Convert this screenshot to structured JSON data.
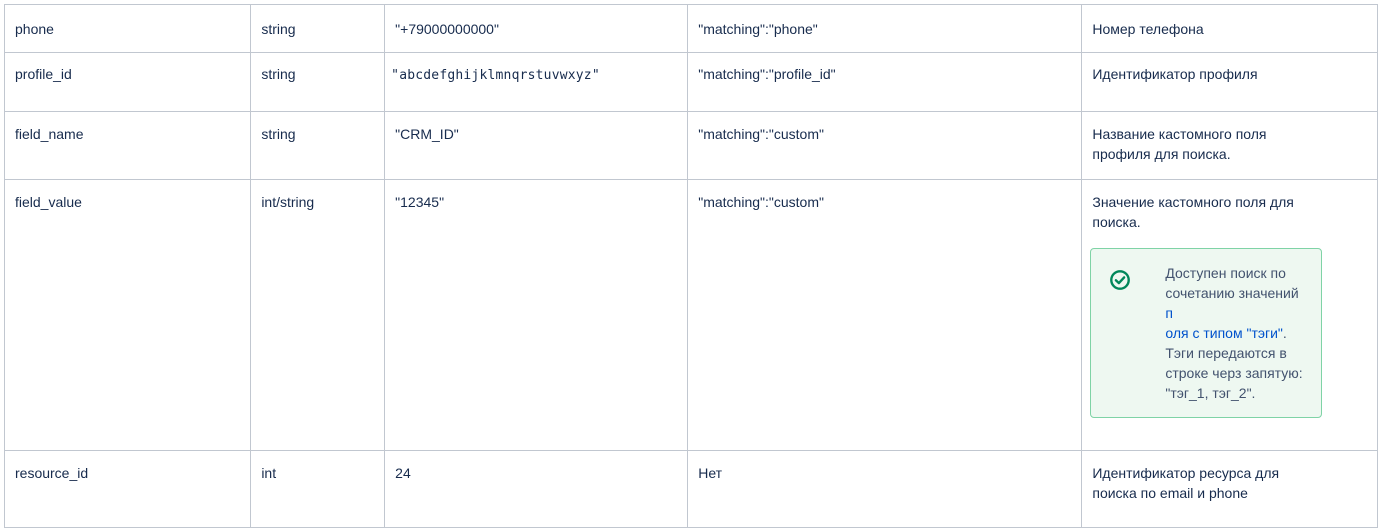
{
  "rows": [
    {
      "name": "phone",
      "type": "string",
      "example": "\"+79000000000\"",
      "matching": "\"matching\":\"phone\"",
      "description": "Номер телефона"
    },
    {
      "name": "profile_id",
      "type": "string",
      "example": "\"abcdefghijklmnqrstuvwxyz\"",
      "matching": "\"matching\":\"profile_id\"",
      "description": "Идентификатор профиля"
    },
    {
      "name": "field_name",
      "type": "string",
      "example": "\"CRM_ID\"",
      "matching": "\"matching\":\"custom\"",
      "description_line1": "Название кастомного поля",
      "description_line2": "профиля для поиска."
    },
    {
      "name": "field_value",
      "type": "int/string",
      "example": "\"12345\"",
      "matching": "\"matching\":\"custom\"",
      "description_line1": "Значение кастомного поля для",
      "description_line2": "поиска.",
      "note": {
        "icon": "check-circle-icon",
        "lines": [
          "Доступен поиск по",
          "сочетанию значений "
        ],
        "link_part1": "п",
        "link_part2": "оля с типом \"тэги\"",
        "after_link": ".",
        "lines_after": [
          "Тэги передаются в",
          "строке черз запятую:",
          "\"тэг_1, тэг_2\"."
        ]
      }
    },
    {
      "name": "resource_id",
      "type": "int",
      "example": "24",
      "matching": "Нет",
      "description_line1": "Идентификатор ресурса для",
      "description_line2": "поиска по email и phone"
    }
  ],
  "colors": {
    "border": "#c1c7d0",
    "text": "#172b4d",
    "note_bg": "#eef8f1",
    "note_border": "#7fd3a6",
    "note_icon": "#00875a",
    "link": "#0052cc"
  }
}
